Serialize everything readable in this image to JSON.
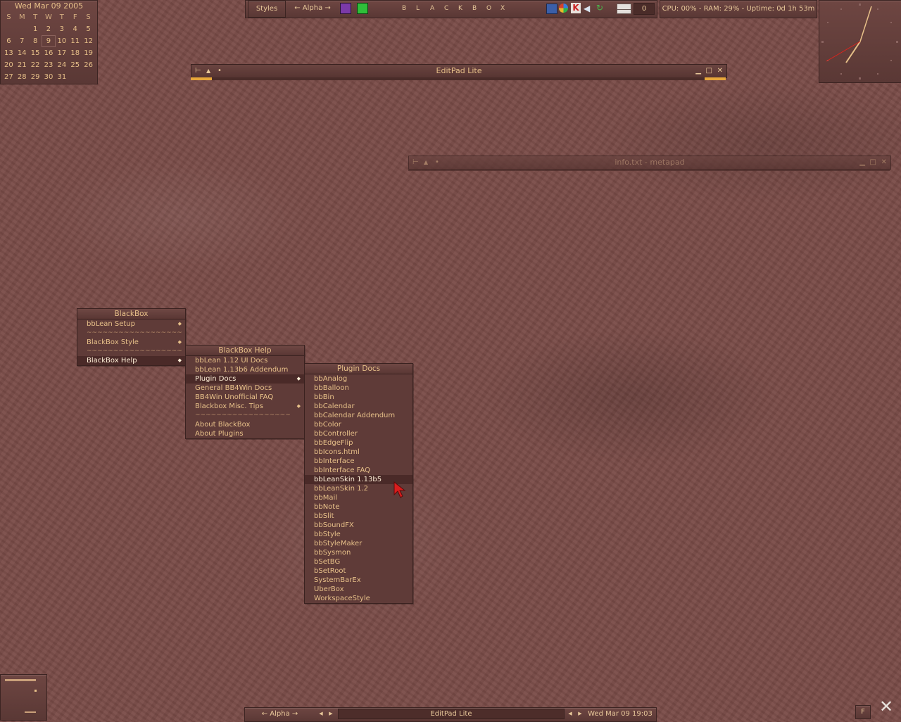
{
  "calendar": {
    "date_label": "Wed Mar 09  2005",
    "weekdays": [
      "S",
      "M",
      "T",
      "W",
      "T",
      "F",
      "S"
    ],
    "days": [
      "",
      "",
      "1",
      "2",
      "3",
      "4",
      "5",
      "6",
      "7",
      "8",
      "9",
      "10",
      "11",
      "12",
      "13",
      "14",
      "15",
      "16",
      "17",
      "18",
      "19",
      "20",
      "21",
      "22",
      "23",
      "24",
      "25",
      "26",
      "27",
      "28",
      "29",
      "30",
      "31",
      "",
      "",
      "",
      "",
      ""
    ],
    "today": "9"
  },
  "toolbar": {
    "styles_label": "Styles",
    "workspace_label": "← Alpha →",
    "letters": [
      "B",
      "L",
      "A",
      "C",
      "K",
      "B",
      "O",
      "X"
    ],
    "mail_count": "0",
    "sysmon": "CPU: 00% - RAM: 29% - Uptime: 0d 1h 53m"
  },
  "colors": {
    "accent": "#e7c089",
    "background": "#7a4c48",
    "clock_hand": "#e0231c"
  },
  "editpad": {
    "title": "EditPad Lite"
  },
  "metapad": {
    "title": "info.txt - metapad"
  },
  "menu_blackbox": {
    "title": "BlackBox",
    "items": [
      "bbLean Setup",
      "BlackBox Style",
      "BlackBox Help"
    ]
  },
  "menu_help": {
    "title": "BlackBox Help",
    "items": [
      "bbLean 1.12 UI Docs",
      "bbLean 1.13b6 Addendum",
      "Plugin Docs",
      "General BB4Win Docs",
      "BB4Win Unofficial FAQ",
      "Blackbox Misc. Tips",
      "About BlackBox",
      "About Plugins"
    ]
  },
  "menu_plugins": {
    "title": "Plugin Docs",
    "items": [
      "bbAnalog",
      "bbBalloon",
      "bbBin",
      "bbCalendar",
      "bbCalendar Addendum",
      "bbColor",
      "bbController",
      "bbEdgeFlip",
      "bbIcons.html",
      "bbInterface",
      "bbInterface FAQ",
      "bbLeanSkin 1.13b5",
      "bbLeanSkin 1.2",
      "bbMail",
      "bbNote",
      "bbSlit",
      "bbSoundFX",
      "bbStyle",
      "bbStyleMaker",
      "bbSysmon",
      "bSetBG",
      "bSetRoot",
      "SystemBarEx",
      "UberBox",
      "WorkspaceStyle"
    ],
    "highlighted": "bbLeanSkin 1.13b5"
  },
  "separator_text": "~~~~~~~~~~~~~~~~~~",
  "taskbar": {
    "workspace_label": "← Alpha →",
    "task_title": "EditPad Lite",
    "clock": "Wed Mar 09 19:03",
    "f_label": "F"
  }
}
